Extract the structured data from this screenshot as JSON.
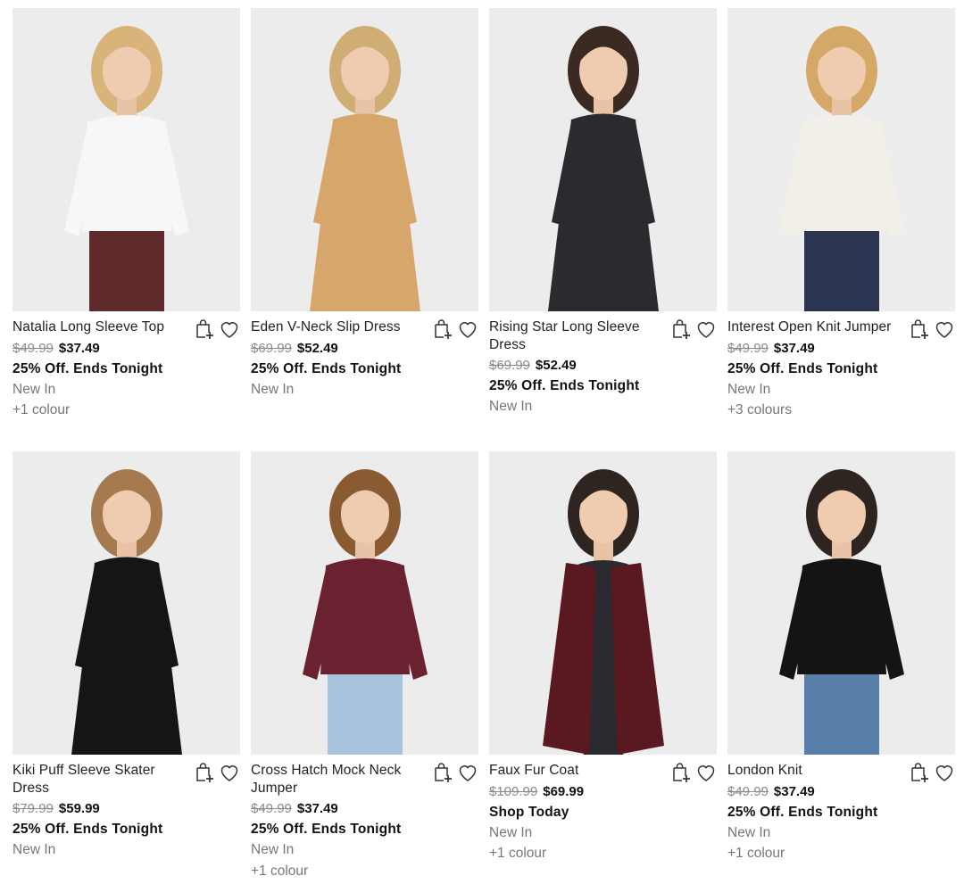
{
  "products": [
    {
      "name": "Natalia Long Sleeve Top",
      "was_price": "$49.99",
      "price": "$37.49",
      "promo": "25% Off. Ends Tonight",
      "status": "New In",
      "colours": "+1 colour",
      "add_to_bag_icon": "shopping-bag-plus-icon",
      "wishlist_icon": "heart-outline-icon",
      "colors": {
        "top": "#f7f7f7",
        "bottom": "#5e2a2c",
        "hair": "#d9b47a",
        "bg": "#ececec"
      }
    },
    {
      "name": "Eden V-Neck Slip Dress",
      "was_price": "$69.99",
      "price": "$52.49",
      "promo": "25% Off. Ends Tonight",
      "status": "New In",
      "colours": "",
      "add_to_bag_icon": "shopping-bag-plus-icon",
      "wishlist_icon": "heart-outline-icon",
      "colors": {
        "top": "#d7a66b",
        "bottom": "#d7a66b",
        "hair": "#d1ad76",
        "bg": "#ececec"
      }
    },
    {
      "name": "Rising Star Long Sleeve Dress",
      "was_price": "$69.99",
      "price": "$52.49",
      "promo": "25% Off. Ends Tonight",
      "status": "New In",
      "colours": "",
      "add_to_bag_icon": "shopping-bag-plus-icon",
      "wishlist_icon": "heart-outline-icon",
      "colors": {
        "top": "#2c2a2f",
        "bottom": "#3a3640",
        "hair": "#3a2a22",
        "bg": "#ececec"
      }
    },
    {
      "name": "Interest Open Knit Jumper",
      "was_price": "$49.99",
      "price": "$37.49",
      "promo": "25% Off. Ends Tonight",
      "status": "New In",
      "colours": "+3 colours",
      "add_to_bag_icon": "shopping-bag-plus-icon",
      "wishlist_icon": "heart-outline-icon",
      "colors": {
        "top": "#f2efe8",
        "bottom": "#2b3552",
        "hair": "#d6a868",
        "bg": "#ededed"
      }
    },
    {
      "name": "Kiki Puff Sleeve Skater Dress",
      "was_price": "$79.99",
      "price": "$59.99",
      "promo": "25% Off. Ends Tonight",
      "status": "New In",
      "colours": "",
      "add_to_bag_icon": "shopping-bag-plus-icon",
      "wishlist_icon": "heart-outline-icon",
      "colors": {
        "top": "#151515",
        "bottom": "#1c1c1c",
        "hair": "#a47a4e",
        "bg": "#ececec"
      }
    },
    {
      "name": "Cross Hatch Mock Neck Jumper",
      "was_price": "$49.99",
      "price": "$37.49",
      "promo": "25% Off. Ends Tonight",
      "status": "New In",
      "colours": "+1 colour",
      "add_to_bag_icon": "shopping-bag-plus-icon",
      "wishlist_icon": "heart-outline-icon",
      "colors": {
        "top": "#6b2230",
        "bottom": "#a9c3dd",
        "hair": "#8a5a32",
        "bg": "#ececec"
      }
    },
    {
      "name": "Faux Fur Coat",
      "was_price": "$109.99",
      "price": "$69.99",
      "promo": "Shop Today",
      "status": "New In",
      "colours": "+1 colour",
      "add_to_bag_icon": "shopping-bag-plus-icon",
      "wishlist_icon": "heart-outline-icon",
      "colors": {
        "top": "#5a1820",
        "bottom": "#2a2a30",
        "hair": "#2e2420",
        "bg": "#ececec"
      }
    },
    {
      "name": "London Knit",
      "was_price": "$49.99",
      "price": "$37.49",
      "promo": "25% Off. Ends Tonight",
      "status": "New In",
      "colours": "+1 colour",
      "add_to_bag_icon": "shopping-bag-plus-icon",
      "wishlist_icon": "heart-outline-icon",
      "colors": {
        "top": "#141414",
        "bottom": "#5a7eaa",
        "hair": "#2e2420",
        "bg": "#ececec"
      }
    }
  ]
}
